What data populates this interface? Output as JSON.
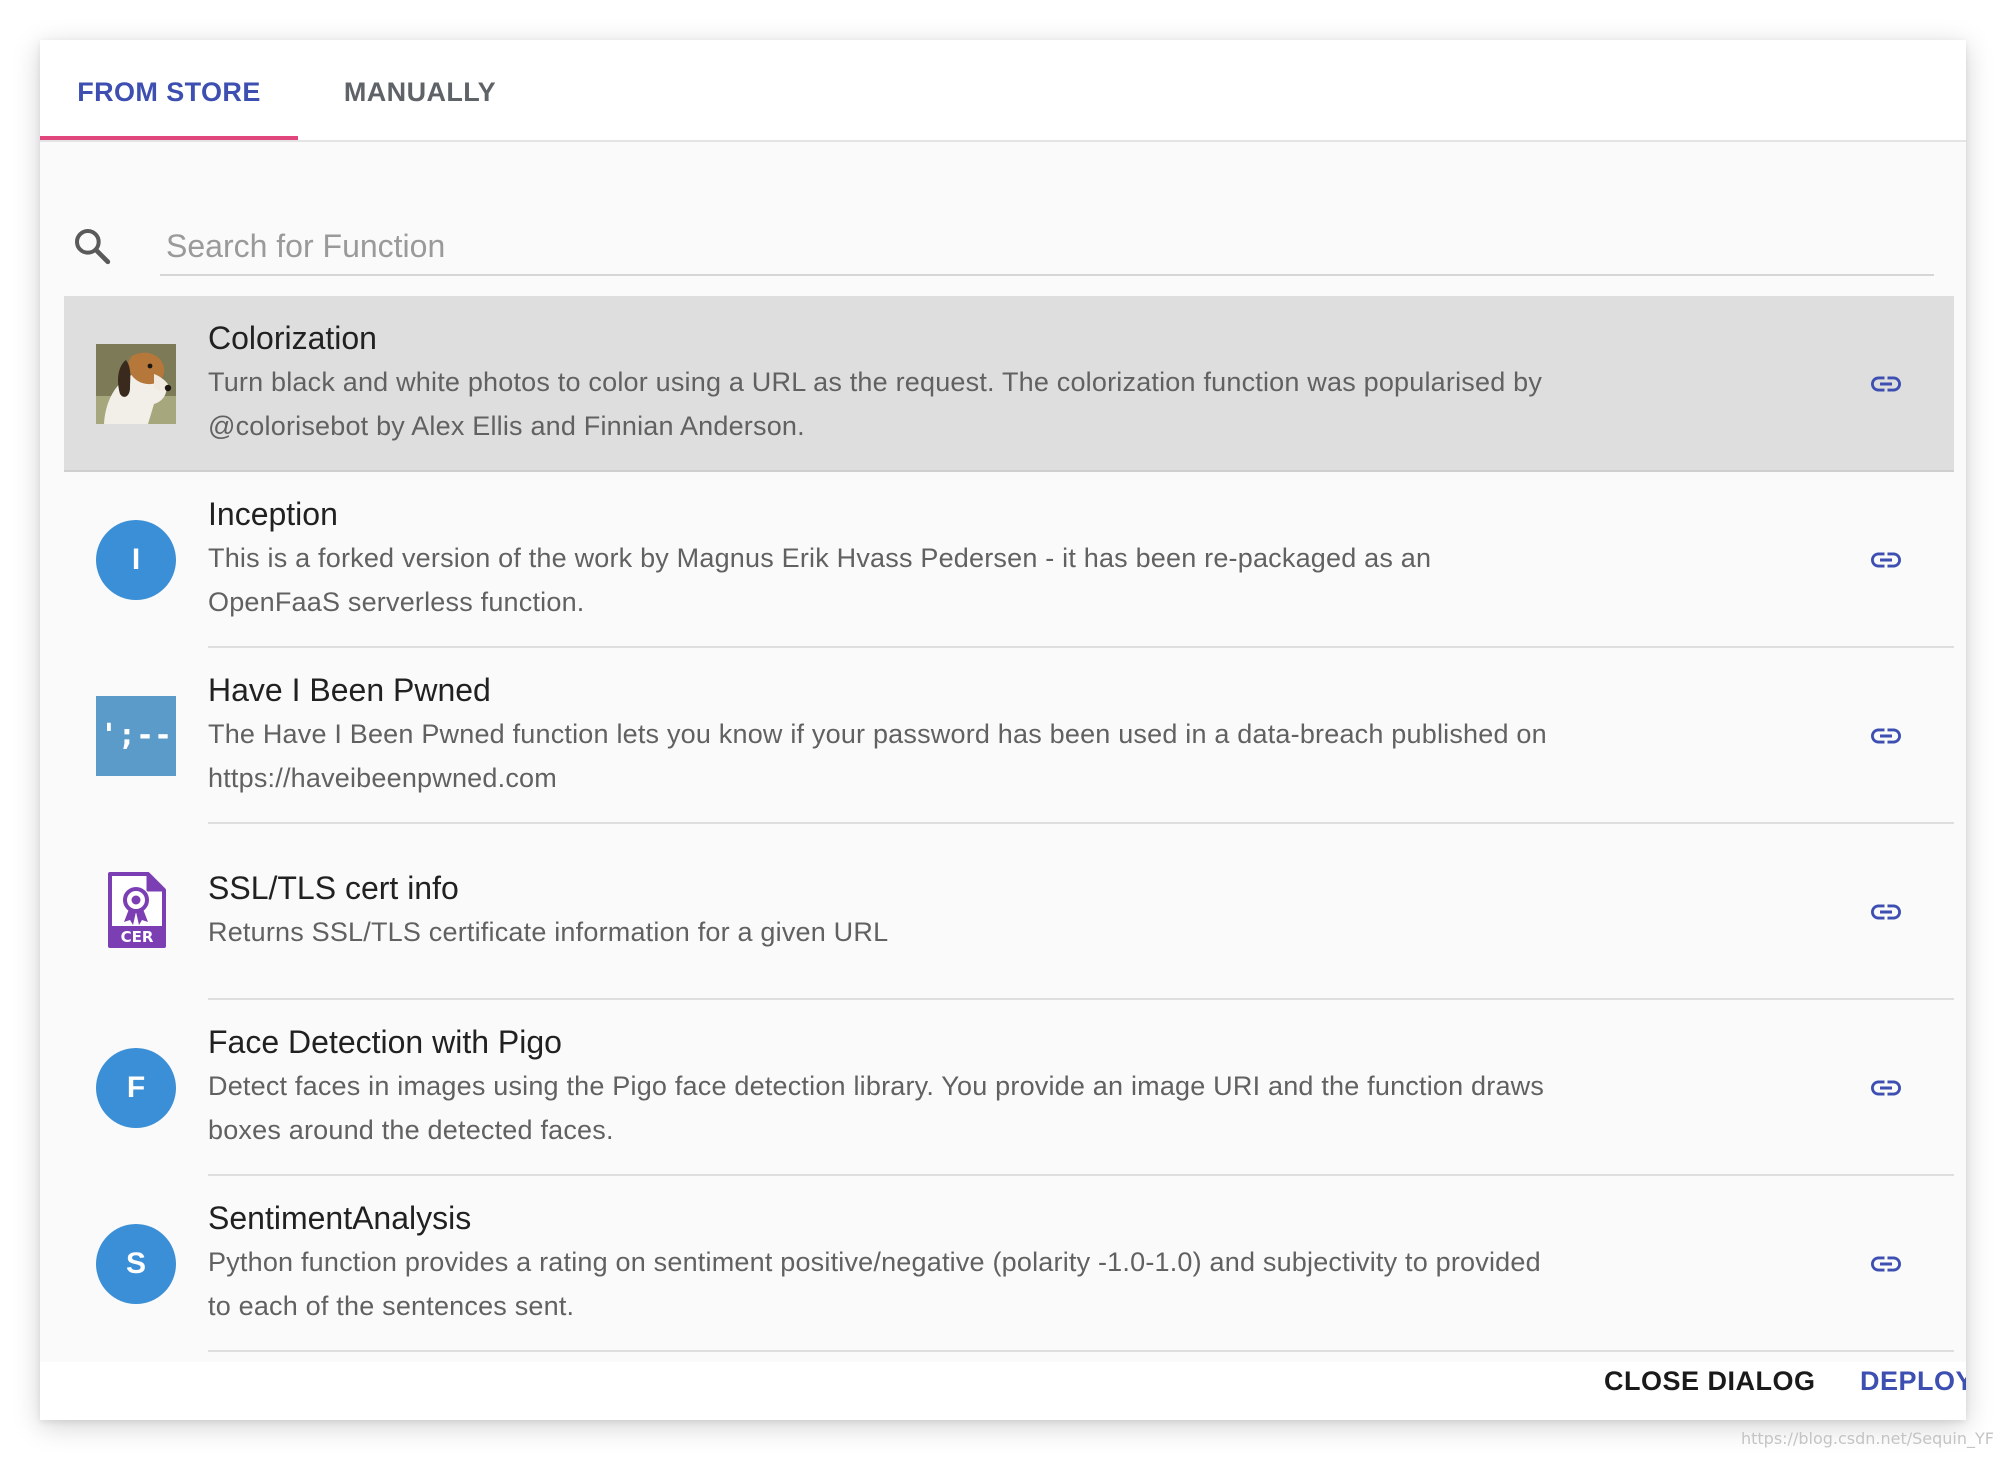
{
  "tabs": [
    {
      "label": "FROM STORE",
      "active": true
    },
    {
      "label": "MANUALLY",
      "active": false
    }
  ],
  "search": {
    "placeholder": "Search for Function",
    "value": "",
    "icon": "search-icon"
  },
  "functions": [
    {
      "title": "Colorization",
      "description": "Turn black and white photos to color using a URL as the request. The colorization function was popularised by @colorisebot by Alex Ellis and Finnian Anderson.",
      "icon": "beagle-photo",
      "selected": true
    },
    {
      "title": "Inception",
      "description": "This is a forked version of the work by Magnus Erik Hvass Pedersen - it has been re-packaged as an OpenFaaS serverless function.",
      "icon_letter": "I",
      "selected": false
    },
    {
      "title": "Have I Been Pwned",
      "description": "The Have I Been Pwned function lets you know if your password has been used in a data-breach published on https://haveibeenpwned.com",
      "icon_text": "';--",
      "selected": false
    },
    {
      "title": "SSL/TLS cert info",
      "description": "Returns SSL/TLS certificate information for a given URL",
      "icon_text": "CER",
      "selected": false
    },
    {
      "title": "Face Detection with Pigo",
      "description": "Detect faces in images using the Pigo face detection library. You provide an image URI and the function draws boxes around the detected faces.",
      "icon_letter": "F",
      "selected": false
    },
    {
      "title": "SentimentAnalysis",
      "description": "Python function provides a rating on sentiment positive/negative (polarity -1.0-1.0) and subjectivity to provided to each of the sentences sent.",
      "icon_letter": "S",
      "selected": false
    }
  ],
  "actions": {
    "close_label": "CLOSE DIALOG",
    "deploy_label": "DEPLOY"
  },
  "watermark": "https://blog.csdn.net/Sequin_YF",
  "colors": {
    "accent": "#3d4fb0",
    "tab_indicator": "#e0457b",
    "avatar_blue": "#3b8fd6",
    "selected_row": "#dedede",
    "cert_purple": "#7b3fb3"
  }
}
